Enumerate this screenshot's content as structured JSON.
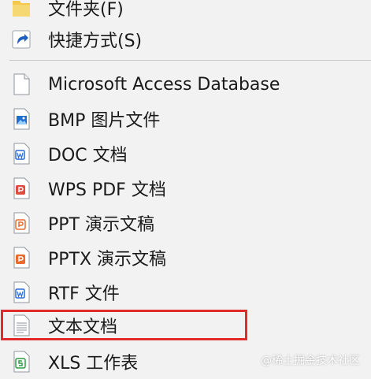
{
  "menu": {
    "items": [
      {
        "label": "文件夹(F)",
        "icon": "folder-icon"
      },
      {
        "label": "快捷方式(S)",
        "icon": "shortcut-icon"
      },
      {
        "label": "Microsoft Access Database",
        "icon": "blank-file-icon"
      },
      {
        "label": "BMP 图片文件",
        "icon": "image-file-icon"
      },
      {
        "label": "DOC 文档",
        "icon": "word-doc-icon"
      },
      {
        "label": "WPS PDF 文档",
        "icon": "pdf-file-icon"
      },
      {
        "label": "PPT 演示文稿",
        "icon": "ppt-file-icon"
      },
      {
        "label": "PPTX 演示文稿",
        "icon": "pptx-file-icon"
      },
      {
        "label": "RTF 文件",
        "icon": "rtf-file-icon"
      },
      {
        "label": "文本文档",
        "icon": "text-file-icon"
      },
      {
        "label": "XLS 工作表",
        "icon": "excel-file-icon"
      }
    ]
  },
  "watermark": "@稀土掘金技术社区",
  "colors": {
    "highlight": "#e12b2b",
    "word_blue": "#2b6cd6",
    "pdf_red": "#e04a3f",
    "ppt_orange": "#e96a2c",
    "excel_green": "#2f9e44",
    "folder_yellow": "#f2c94c"
  }
}
